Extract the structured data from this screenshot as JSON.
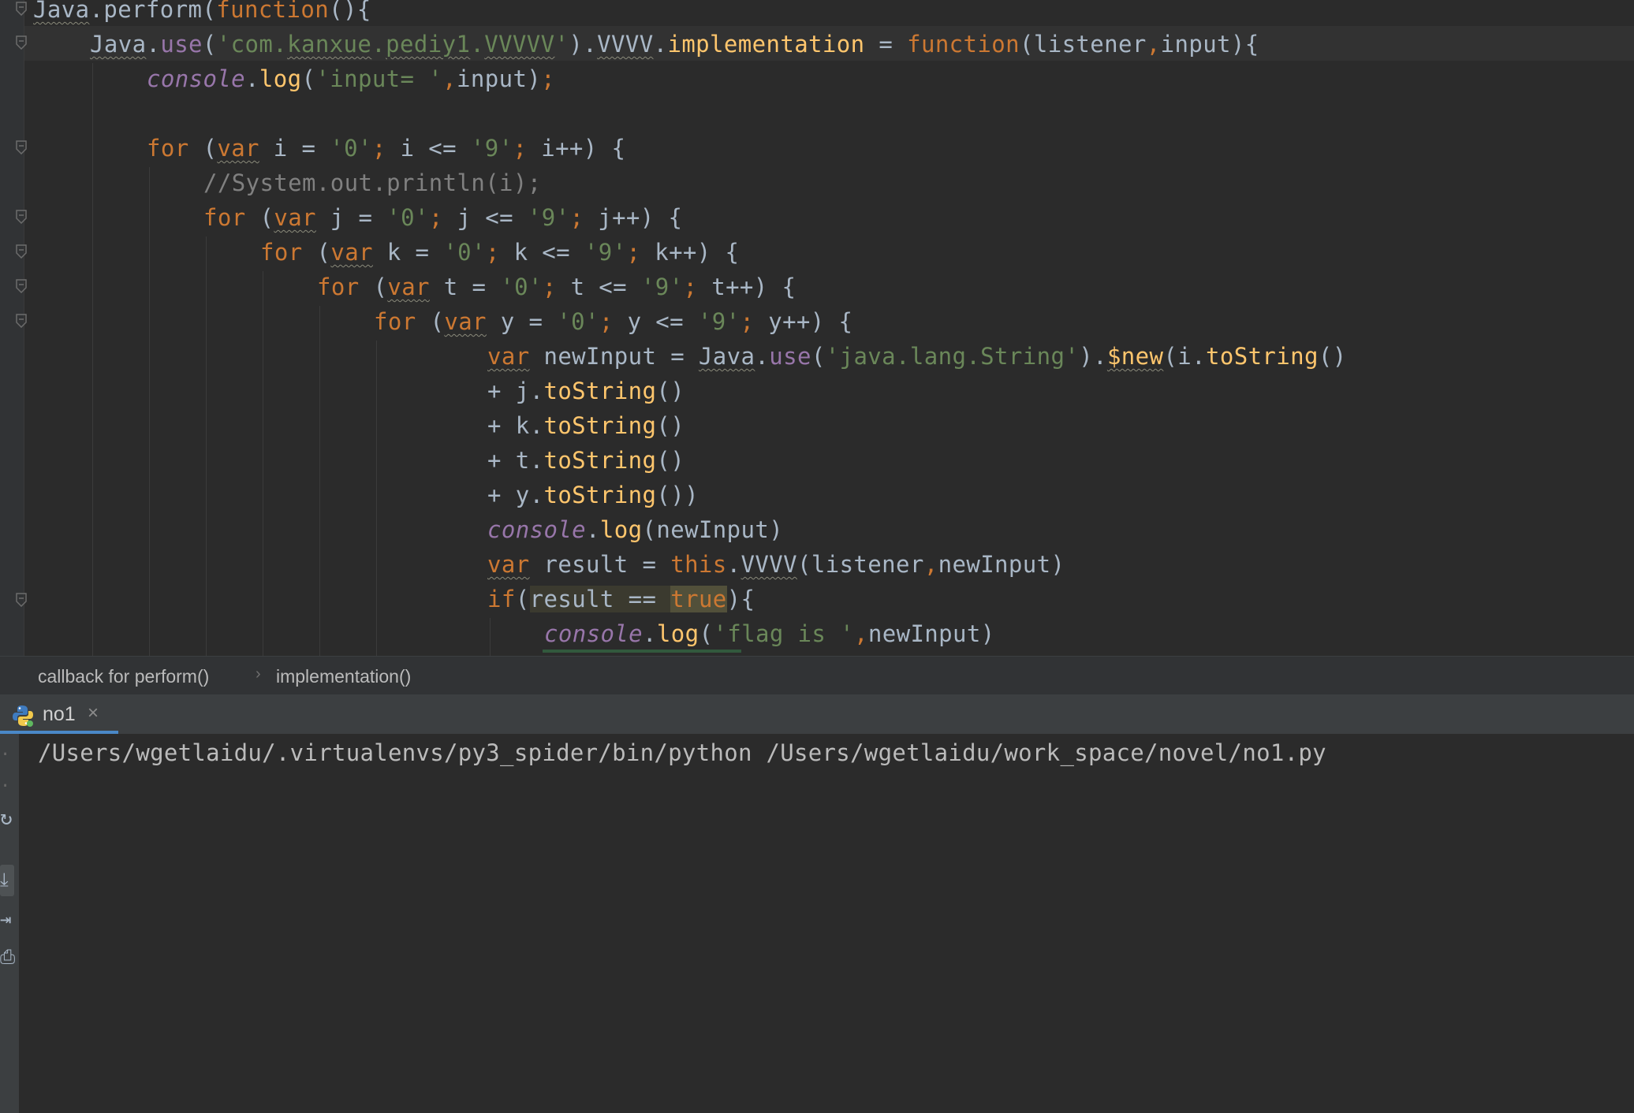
{
  "editor": {
    "lines": [
      {
        "parts": [
          [
            "wavy",
            "Java"
          ],
          [
            "",
            "."
          ],
          [
            "",
            "perform"
          ],
          [
            "",
            "("
          ],
          [
            "kw",
            "function"
          ],
          [
            "",
            "(){"
          ]
        ]
      },
      {
        "parts": [
          [
            "wavy",
            "Java"
          ],
          [
            "",
            "."
          ],
          [
            "prop",
            "use"
          ],
          [
            "",
            "("
          ],
          [
            "str",
            "'com."
          ],
          [
            "str wavy",
            "kanxue"
          ],
          [
            "str",
            "."
          ],
          [
            "str wavy",
            "pediy1"
          ],
          [
            "str",
            "."
          ],
          [
            "str wavy",
            "VVVVV"
          ],
          [
            "str",
            "'"
          ],
          [
            "",
            ")."
          ],
          [
            "wavy",
            "VVVV"
          ],
          [
            "",
            "."
          ],
          [
            "fn",
            "implementation"
          ],
          [
            "",
            " = "
          ],
          [
            "kw",
            "function"
          ],
          [
            "",
            "(listener"
          ],
          [
            "kw",
            ","
          ],
          [
            "",
            "input){"
          ]
        ]
      },
      {
        "parts": [
          [
            "ital",
            "console"
          ],
          [
            "",
            "."
          ],
          [
            "fn",
            "log"
          ],
          [
            "",
            "("
          ],
          [
            "str",
            "'input= '"
          ],
          [
            "kw",
            ","
          ],
          [
            "",
            "input)"
          ],
          [
            "kw",
            ";"
          ]
        ]
      },
      {
        "parts": []
      },
      {
        "parts": [
          [
            "kw",
            "for"
          ],
          [
            "",
            " ("
          ],
          [
            "kw wavy",
            "var"
          ],
          [
            "",
            " i = "
          ],
          [
            "str",
            "'0'"
          ],
          [
            "kw",
            ";"
          ],
          [
            "",
            " i <= "
          ],
          [
            "str",
            "'9'"
          ],
          [
            "kw",
            ";"
          ],
          [
            "",
            " i++) {"
          ]
        ]
      },
      {
        "parts": [
          [
            "cmt",
            "//System.out.println(i);"
          ]
        ]
      },
      {
        "parts": [
          [
            "kw",
            "for"
          ],
          [
            "",
            " ("
          ],
          [
            "kw wavy",
            "var"
          ],
          [
            "",
            " j = "
          ],
          [
            "str",
            "'0'"
          ],
          [
            "kw",
            ";"
          ],
          [
            "",
            " j <= "
          ],
          [
            "str",
            "'9'"
          ],
          [
            "kw",
            ";"
          ],
          [
            "",
            " j++) {"
          ]
        ]
      },
      {
        "parts": [
          [
            "kw",
            "for"
          ],
          [
            "",
            " ("
          ],
          [
            "kw wavy",
            "var"
          ],
          [
            "",
            " k = "
          ],
          [
            "str",
            "'0'"
          ],
          [
            "kw",
            ";"
          ],
          [
            "",
            " k <= "
          ],
          [
            "str",
            "'9'"
          ],
          [
            "kw",
            ";"
          ],
          [
            "",
            " k++) {"
          ]
        ]
      },
      {
        "parts": [
          [
            "kw",
            "for"
          ],
          [
            "",
            " ("
          ],
          [
            "kw wavy",
            "var"
          ],
          [
            "",
            " t = "
          ],
          [
            "str",
            "'0'"
          ],
          [
            "kw",
            ";"
          ],
          [
            "",
            " t <= "
          ],
          [
            "str",
            "'9'"
          ],
          [
            "kw",
            ";"
          ],
          [
            "",
            " t++) {"
          ]
        ]
      },
      {
        "parts": [
          [
            "kw",
            "for"
          ],
          [
            "",
            " ("
          ],
          [
            "kw wavy",
            "var"
          ],
          [
            "",
            " y = "
          ],
          [
            "str",
            "'0'"
          ],
          [
            "kw",
            ";"
          ],
          [
            "",
            " y <= "
          ],
          [
            "str",
            "'9'"
          ],
          [
            "kw",
            ";"
          ],
          [
            "",
            " y++) {"
          ]
        ]
      },
      {
        "parts": [
          [
            "kw wavy",
            "var"
          ],
          [
            "",
            " newInput = "
          ],
          [
            "wavy",
            "Java"
          ],
          [
            "",
            "."
          ],
          [
            "prop",
            "use"
          ],
          [
            "",
            "("
          ],
          [
            "str",
            "'java.lang.String'"
          ],
          [
            "",
            ")."
          ],
          [
            "fn wavy",
            "$new"
          ],
          [
            "",
            "(i."
          ],
          [
            "fn",
            "toString"
          ],
          [
            "",
            "()"
          ]
        ]
      },
      {
        "parts": [
          [
            "",
            "+ j."
          ],
          [
            "fn",
            "toString"
          ],
          [
            "",
            "()"
          ]
        ]
      },
      {
        "parts": [
          [
            "",
            "+ k."
          ],
          [
            "fn",
            "toString"
          ],
          [
            "",
            "()"
          ]
        ]
      },
      {
        "parts": [
          [
            "",
            "+ t."
          ],
          [
            "fn",
            "toString"
          ],
          [
            "",
            "()"
          ]
        ]
      },
      {
        "parts": [
          [
            "",
            "+ y."
          ],
          [
            "fn",
            "toString"
          ],
          [
            "",
            "())"
          ]
        ]
      },
      {
        "parts": [
          [
            "ital",
            "console"
          ],
          [
            "",
            "."
          ],
          [
            "fn",
            "log"
          ],
          [
            "",
            "(newInput)"
          ]
        ]
      },
      {
        "parts": [
          [
            "kw wavy",
            "var"
          ],
          [
            "",
            " result = "
          ],
          [
            "kw",
            "this"
          ],
          [
            "",
            "."
          ],
          [
            "wavy",
            "VVVV"
          ],
          [
            "",
            "(listener"
          ],
          [
            "kw",
            ","
          ],
          [
            "",
            "newInput)"
          ]
        ]
      },
      {
        "parts": [
          [
            "kw",
            "if"
          ],
          [
            "",
            "("
          ],
          [
            "hl",
            "result == "
          ],
          [
            "hl-true",
            "true"
          ],
          [
            "",
            "){"
          ]
        ]
      },
      {
        "parts": [
          [
            "ital",
            "console"
          ],
          [
            "",
            "."
          ],
          [
            "fn",
            "log"
          ],
          [
            "",
            "("
          ],
          [
            "str",
            "'flag is '"
          ],
          [
            "kw",
            ","
          ],
          [
            "",
            "newInput)"
          ]
        ]
      }
    ]
  },
  "breadcrumbs": {
    "item1": "callback for perform()",
    "separator": "›",
    "item2": "implementation()"
  },
  "run_tab": {
    "label": "no1",
    "close_glyph": "×",
    "icon": "python-icon"
  },
  "console": {
    "output": "/Users/wgetlaidu/.virtualenvs/py3_spider/bin/python /Users/wgetlaidu/work_space/novel/no1.py"
  },
  "colors": {
    "background": "#2b2b2b",
    "keyword": "#cc7832",
    "string": "#6a8759",
    "function": "#ffc66d",
    "identifier": "#a9b7c6",
    "comment": "#808080"
  }
}
